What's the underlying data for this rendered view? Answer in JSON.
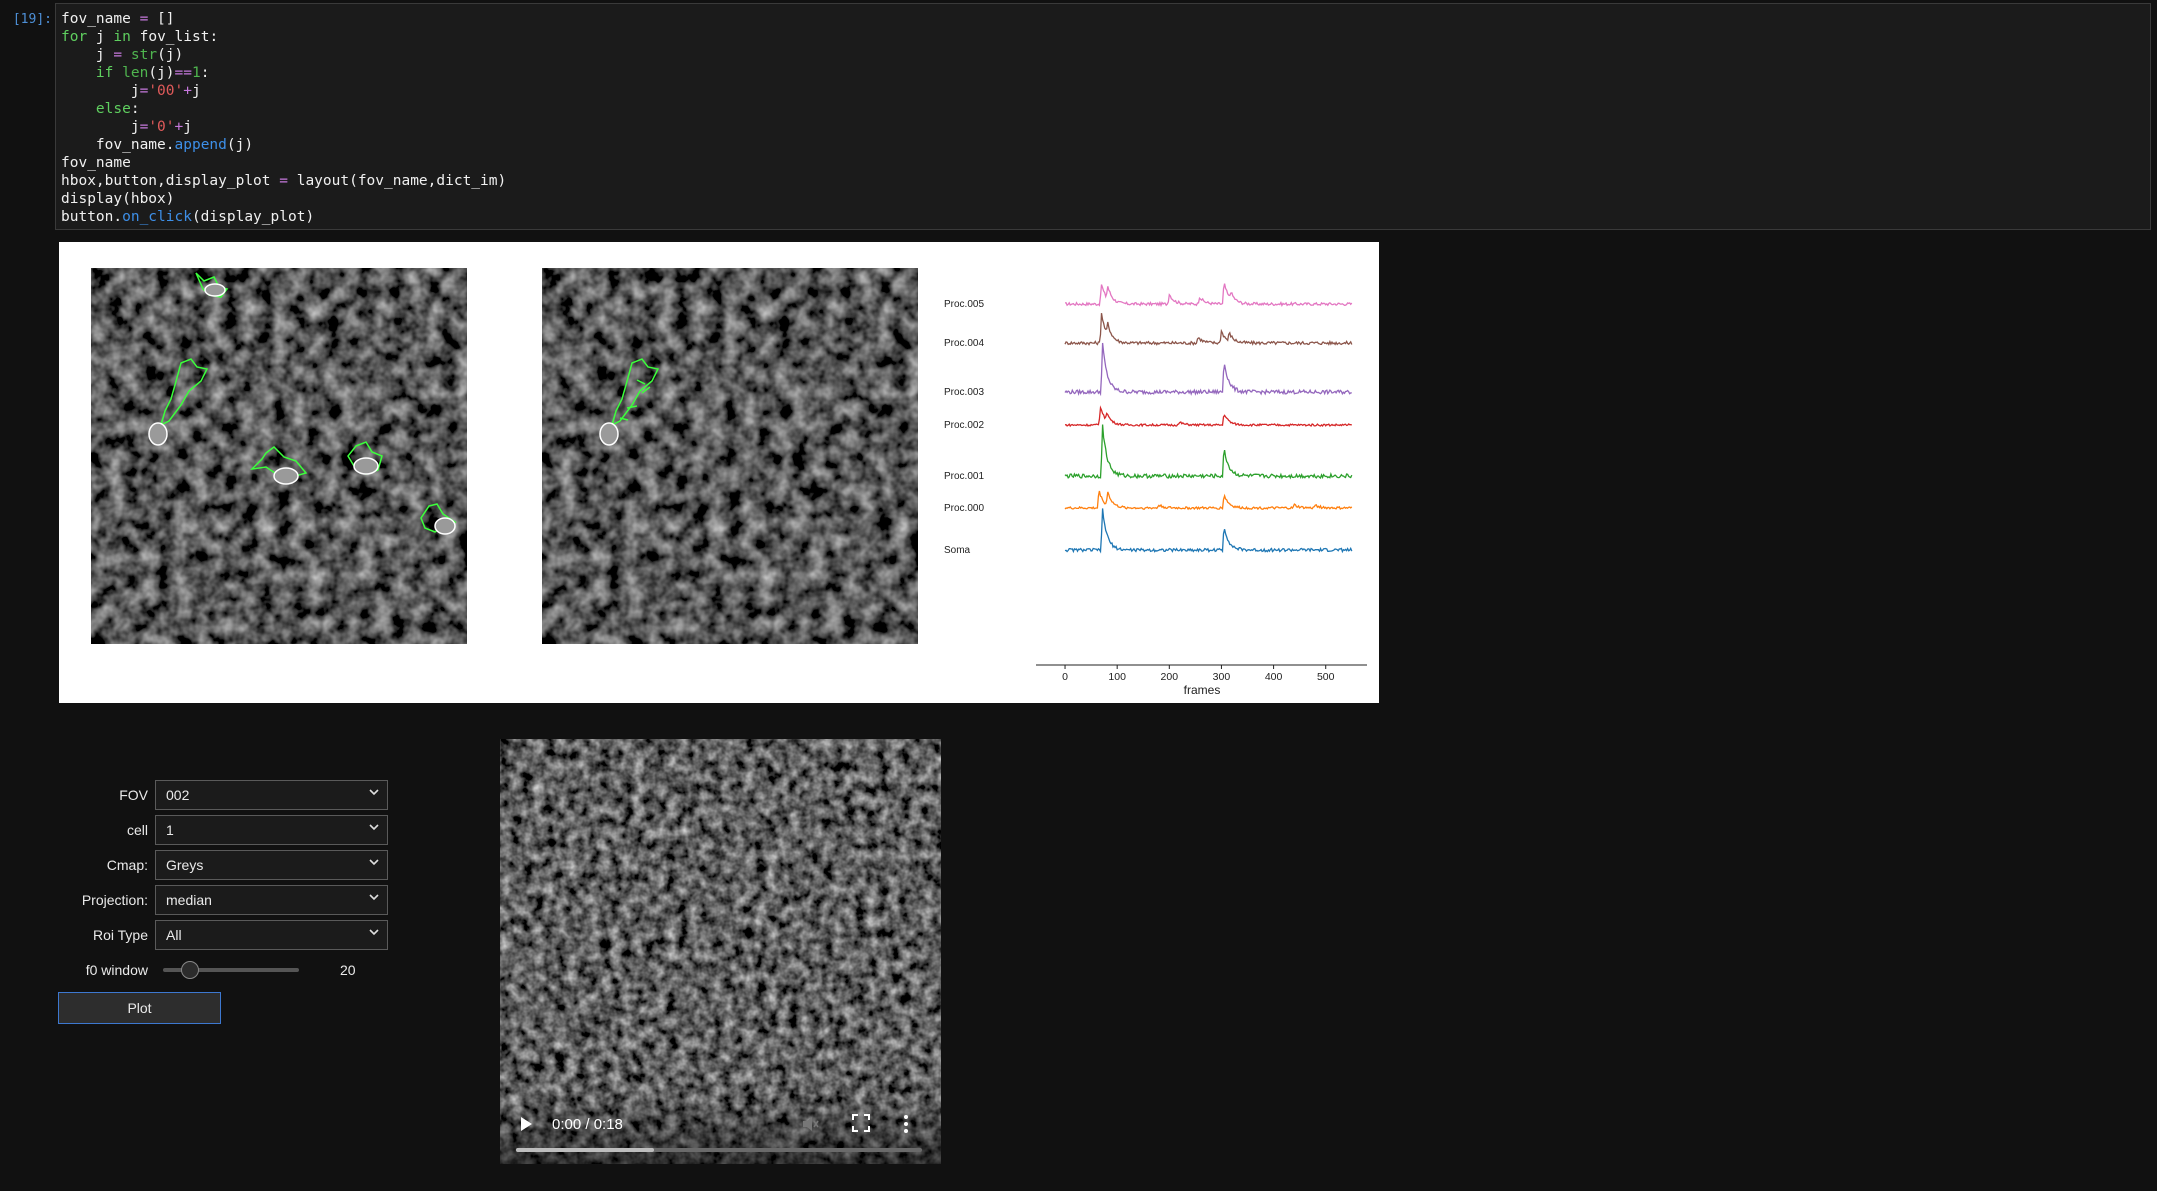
{
  "cell": {
    "prompt": "[19]:",
    "code_lines": [
      [
        {
          "t": "fov_name "
        },
        {
          "t": "=",
          "c": "op"
        },
        {
          "t": " []"
        }
      ],
      [
        {
          "t": "for",
          "c": "kw"
        },
        {
          "t": " j "
        },
        {
          "t": "in",
          "c": "kw"
        },
        {
          "t": " fov_list:"
        }
      ],
      [
        {
          "t": "    j "
        },
        {
          "t": "=",
          "c": "op"
        },
        {
          "t": " "
        },
        {
          "t": "str",
          "c": "bi"
        },
        {
          "t": "(j)"
        }
      ],
      [
        {
          "t": "    "
        },
        {
          "t": "if",
          "c": "kw"
        },
        {
          "t": " "
        },
        {
          "t": "len",
          "c": "bi"
        },
        {
          "t": "(j)"
        },
        {
          "t": "==",
          "c": "op"
        },
        {
          "t": "1",
          "c": "num"
        },
        {
          "t": ":"
        }
      ],
      [
        {
          "t": "        j"
        },
        {
          "t": "=",
          "c": "op"
        },
        {
          "t": "'00'",
          "c": "str"
        },
        {
          "t": "+",
          "c": "op"
        },
        {
          "t": "j"
        }
      ],
      [
        {
          "t": "    "
        },
        {
          "t": "else",
          "c": "kw"
        },
        {
          "t": ":"
        }
      ],
      [
        {
          "t": "        j"
        },
        {
          "t": "=",
          "c": "op"
        },
        {
          "t": "'0'",
          "c": "str"
        },
        {
          "t": "+",
          "c": "op"
        },
        {
          "t": "j"
        }
      ],
      [
        {
          "t": "    fov_name."
        },
        {
          "t": "append",
          "c": "fn"
        },
        {
          "t": "(j)"
        }
      ],
      [
        {
          "t": "fov_name"
        }
      ],
      [
        {
          "t": "hbox,button,display_plot "
        },
        {
          "t": "=",
          "c": "op"
        },
        {
          "t": " layout(fov_name,dict_im)"
        }
      ],
      [
        {
          "t": "display(hbox)"
        }
      ],
      [
        {
          "t": "button."
        },
        {
          "t": "on_click",
          "c": "fn"
        },
        {
          "t": "(display_plot)"
        }
      ]
    ]
  },
  "chart_data": {
    "type": "line",
    "xlabel": "frames",
    "x_ticks": [
      0,
      100,
      200,
      300,
      400,
      500
    ],
    "x_range": [
      -25,
      560
    ],
    "series": [
      {
        "name": "Proc.005",
        "color": "#e377c2",
        "peaks": [
          [
            70,
            0.55
          ],
          [
            82,
            0.35
          ],
          [
            200,
            0.28
          ],
          [
            258,
            0.2
          ],
          [
            305,
            0.6
          ],
          [
            318,
            0.2
          ]
        ]
      },
      {
        "name": "Proc.004",
        "color": "#8c564b",
        "peaks": [
          [
            70,
            0.75
          ],
          [
            82,
            0.3
          ],
          [
            255,
            0.15
          ],
          [
            300,
            0.3
          ],
          [
            315,
            0.2
          ]
        ]
      },
      {
        "name": "Proc.003",
        "color": "#9467bd",
        "peaks": [
          [
            72,
            1.0
          ],
          [
            305,
            0.65
          ]
        ]
      },
      {
        "name": "Proc.002",
        "color": "#d62728",
        "peaks": [
          [
            68,
            0.7
          ],
          [
            80,
            0.3
          ],
          [
            220,
            0.1
          ],
          [
            305,
            0.45
          ]
        ]
      },
      {
        "name": "Proc.001",
        "color": "#2ca02c",
        "peaks": [
          [
            72,
            1.0
          ],
          [
            305,
            0.55
          ]
        ]
      },
      {
        "name": "Proc.000",
        "color": "#ff7f0e",
        "peaks": [
          [
            65,
            0.6
          ],
          [
            82,
            0.45
          ],
          [
            180,
            0.1
          ],
          [
            305,
            0.45
          ],
          [
            440,
            0.1
          ],
          [
            480,
            0.1
          ]
        ]
      },
      {
        "name": "Soma",
        "color": "#1f77b4",
        "peaks": [
          [
            72,
            1.0
          ],
          [
            305,
            0.6
          ]
        ]
      }
    ]
  },
  "controls": {
    "fov": {
      "label": "FOV",
      "value": "002"
    },
    "cell": {
      "label": "cell",
      "value": "1"
    },
    "cmap": {
      "label": "Cmap:",
      "value": "Greys"
    },
    "projection": {
      "label": "Projection:",
      "value": "median"
    },
    "roi_type": {
      "label": "Roi Type",
      "value": "All"
    },
    "f0_window": {
      "label": "f0 window",
      "value": "20",
      "fraction": 0.2
    },
    "plot_label": "Plot"
  },
  "video": {
    "time": "0:00 / 0:18",
    "buffered_fraction": 0.34
  },
  "icons": {
    "play": "play-icon",
    "volume": "volume-muted-icon",
    "fullscreen": "fullscreen-icon",
    "menu": "more-vert-icon",
    "chevron": "chevron-down-icon"
  }
}
